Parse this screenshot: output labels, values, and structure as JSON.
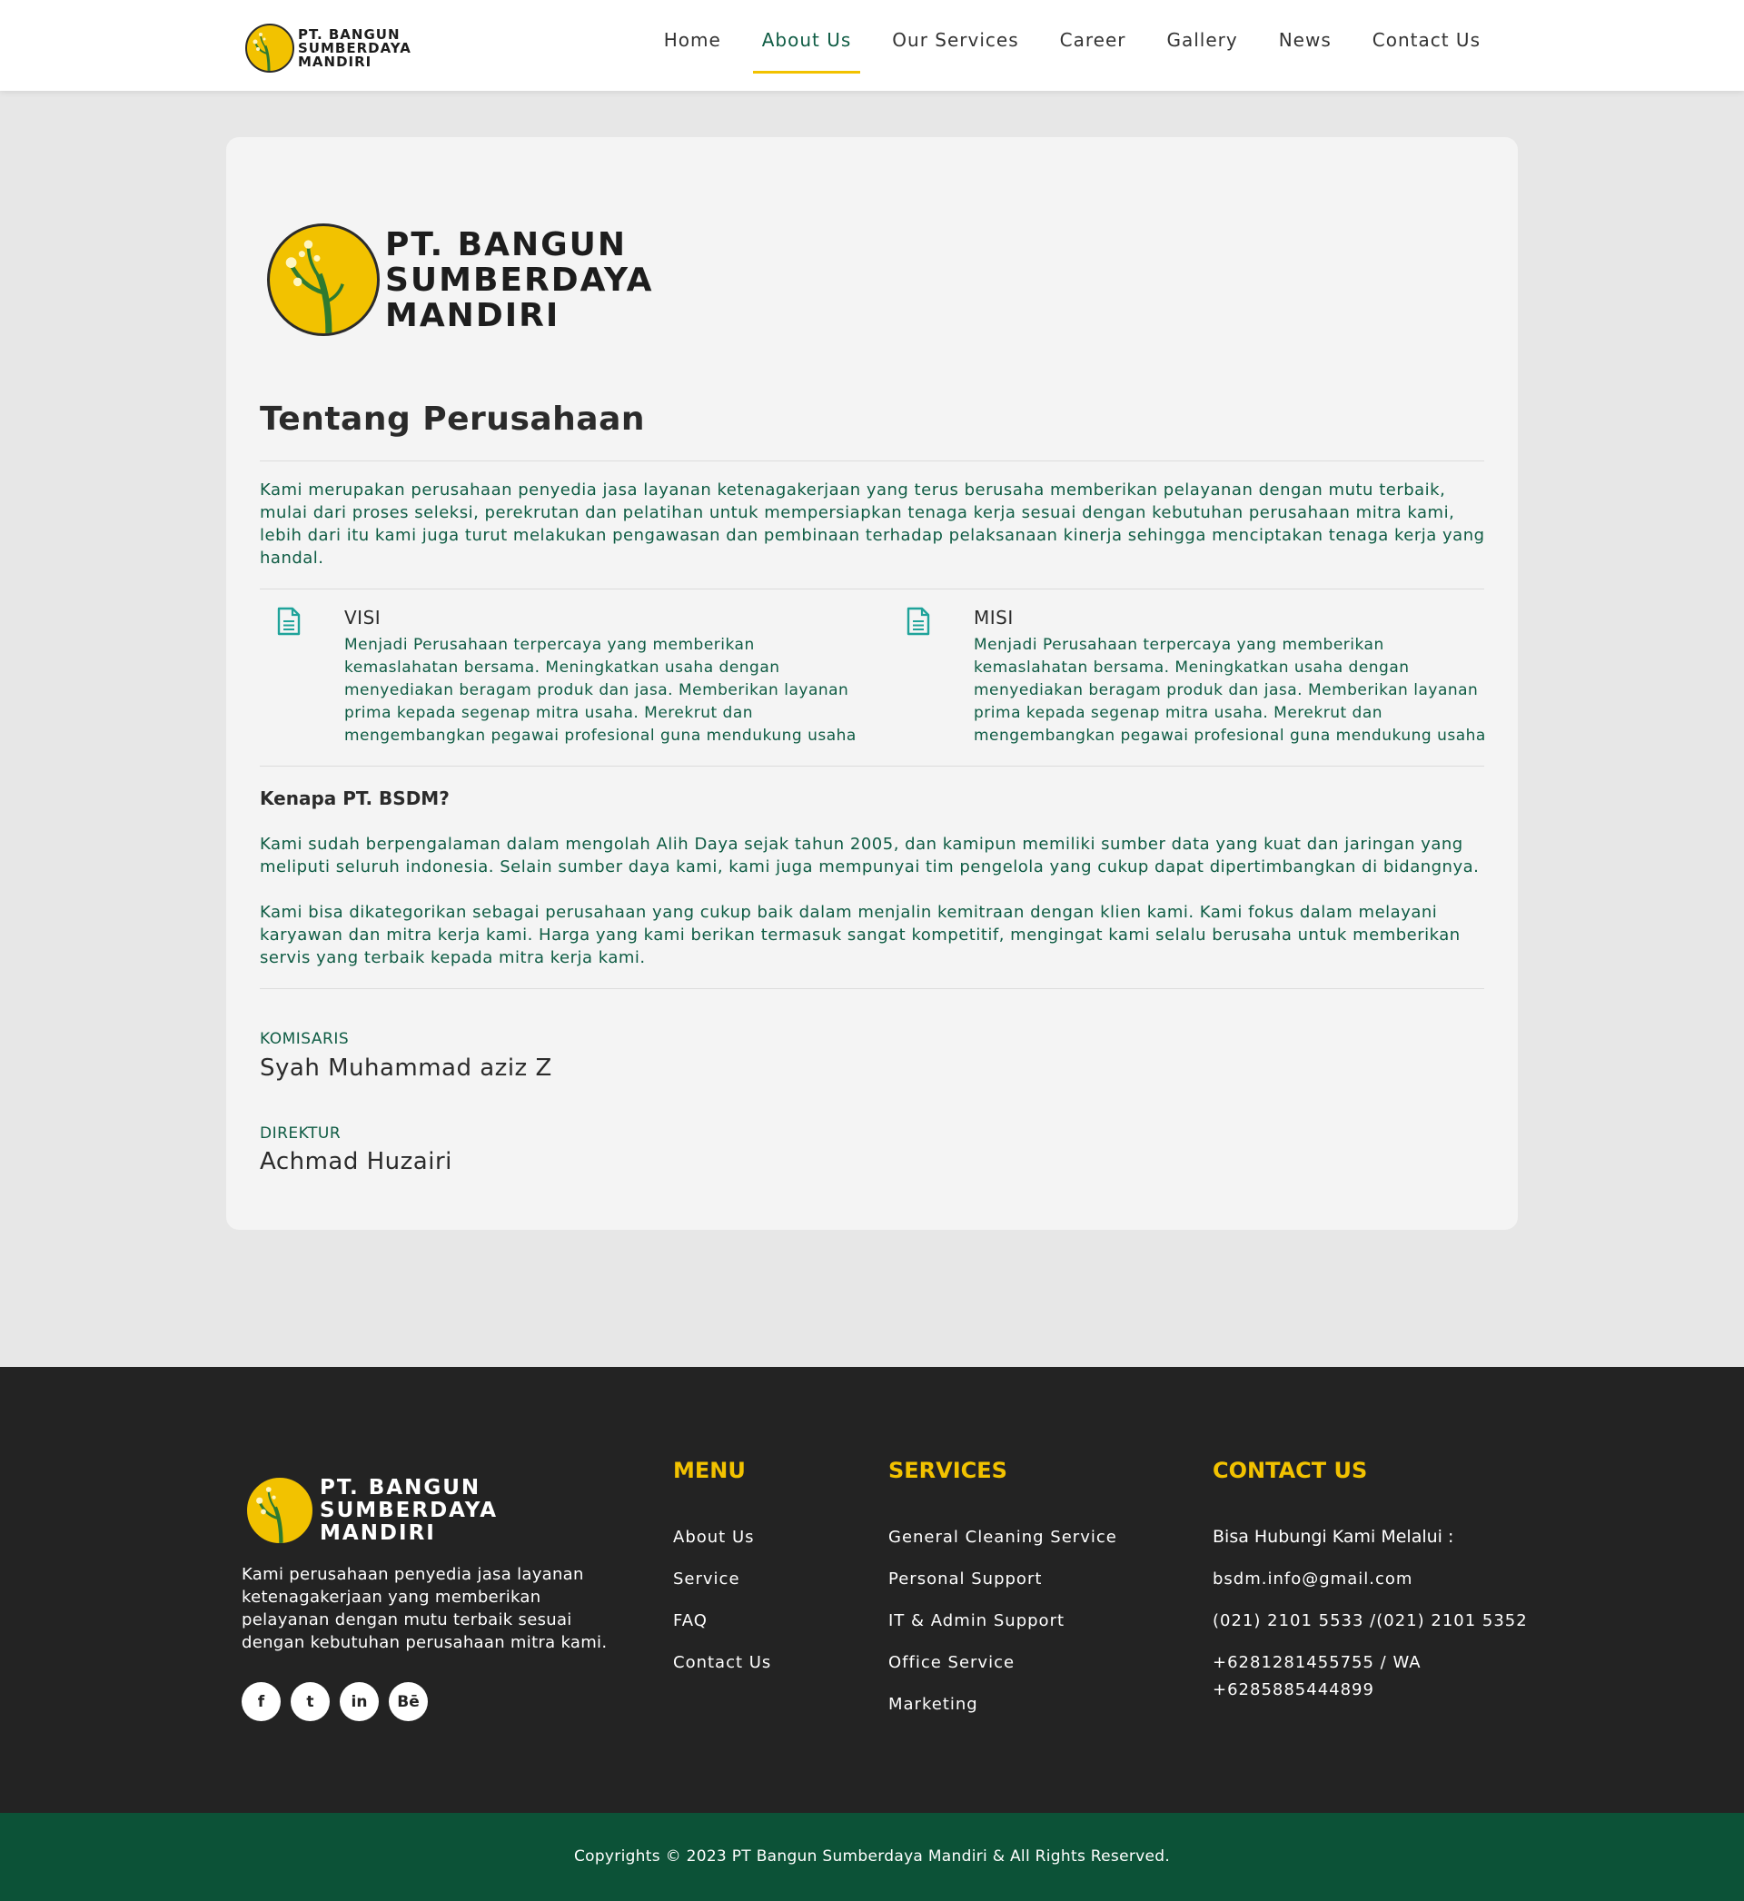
{
  "brand": {
    "line1": "PT. BANGUN",
    "line2": "SUMBERDAYA",
    "line3": "MANDIRI",
    "logo_text": "PT. Bangun Sumberdaya Mandiri"
  },
  "nav": [
    {
      "label": "Home"
    },
    {
      "label": "About Us",
      "active": true
    },
    {
      "label": "Our Services"
    },
    {
      "label": "Career"
    },
    {
      "label": "Gallery"
    },
    {
      "label": "News"
    },
    {
      "label": "Contact Us"
    }
  ],
  "about": {
    "title": "Tentang Perusahaan",
    "intro": "Kami merupakan perusahaan penyedia jasa layanan ketenagakerjaan yang terus berusaha memberikan pelayanan dengan mutu terbaik, mulai dari proses seleksi, perekrutan dan pelatihan untuk mempersiapkan tenaga kerja sesuai dengan kebutuhan perusahaan mitra kami, lebih dari itu kami juga turut melakukan pengawasan dan pembinaan terhadap pelaksanaan kinerja sehingga menciptakan tenaga kerja yang handal.",
    "visi": {
      "title": "VISI",
      "text": "Menjadi Perusahaan terpercaya yang memberikan kemaslahatan bersama. Meningkatkan usaha dengan menyediakan beragam produk dan jasa. Memberikan layanan prima kepada segenap mitra usaha. Merekrut dan mengembangkan pegawai profesional guna mendukung usaha"
    },
    "misi": {
      "title": "MISI",
      "text": "Menjadi Perusahaan terpercaya yang memberikan kemaslahatan bersama. Meningkatkan usaha dengan menyediakan beragam produk dan jasa. Memberikan layanan prima kepada segenap mitra usaha. Merekrut dan mengembangkan pegawai profesional guna mendukung usaha"
    },
    "why_title": "Kenapa PT. BSDM?",
    "why_p1": "Kami sudah berpengalaman dalam mengolah Alih Daya sejak tahun 2005, dan kamipun memiliki sumber data yang kuat dan jaringan yang meliputi seluruh indonesia. Selain sumber daya kami, kami juga mempunyai tim pengelola yang cukup dapat dipertimbangkan di bidangnya.",
    "why_p2": "Kami bisa dikategorikan sebagai perusahaan yang cukup baik dalam menjalin kemitraan dengan klien kami. Kami fokus dalam melayani karyawan dan mitra kerja kami. Harga yang kami berikan termasuk sangat kompetitif, mengingat kami selalu berusaha untuk memberikan servis yang terbaik kepada mitra kerja kami.",
    "komisaris_label": "KOMISARIS",
    "komisaris_name": "Syah Muhammad aziz Z",
    "direktur_label": "DIREKTUR",
    "direktur_name": "Achmad Huzairi"
  },
  "footer": {
    "about": "Kami perusahaan penyedia jasa layanan ketenagakerjaan yang memberikan pelayanan dengan mutu terbaik sesuai dengan kebutuhan perusahaan mitra kami.",
    "socials": [
      {
        "icon": "facebook-icon",
        "glyph": "f"
      },
      {
        "icon": "twitter-icon",
        "glyph": "t"
      },
      {
        "icon": "linkedin-icon",
        "glyph": "in"
      },
      {
        "icon": "behance-icon",
        "glyph": "Bē"
      }
    ],
    "menu_title": "MENU",
    "menu": [
      "About Us",
      "Service",
      "FAQ",
      "Contact Us"
    ],
    "services_title": "SERVICES",
    "services": [
      "General Cleaning Service",
      "Personal Support",
      "IT & Admin Support",
      "Office Service",
      "Marketing"
    ],
    "contact_title": "CONTACT US",
    "contact_lead": "Bisa Hubungi Kami Melalui :",
    "email": "bsdm.info@gmail.com",
    "phone": "(021) 2101 5533 /(021) 2101 5352",
    "wa_line1": "+6281281455755 / WA",
    "wa_line2": "+6285885444899",
    "copyright": "Copyrights © 2023 PT Bangun Sumberdaya Mandiri & All Rights Reserved."
  },
  "colors": {
    "accent": "#f2c200",
    "brand_green": "#0f5c44",
    "footer_bg": "#232323",
    "copy_bg": "#0c5237"
  }
}
